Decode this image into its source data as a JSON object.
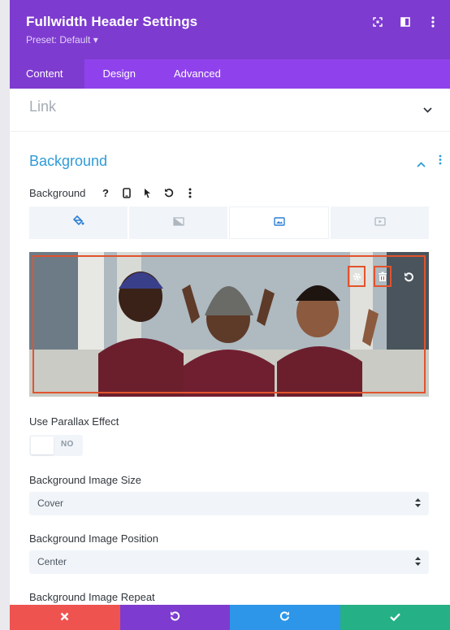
{
  "header": {
    "title": "Fullwidth Header Settings",
    "preset": "Preset: Default ▾",
    "icons": [
      "focus-icon",
      "split-view-icon",
      "more-vertical-icon"
    ],
    "color": "#7e3bd0"
  },
  "tabs": [
    {
      "label": "Content",
      "active": true
    },
    {
      "label": "Design",
      "active": false
    },
    {
      "label": "Advanced",
      "active": false
    }
  ],
  "sections": {
    "link": {
      "label": "Link",
      "expanded": false
    },
    "background": {
      "label": "Background",
      "expanded": true
    }
  },
  "background_option": {
    "label": "Background",
    "help_glyph": "?",
    "tools": [
      "help-icon",
      "device-phone-icon",
      "hover-pointer-icon",
      "reset-icon",
      "more-vertical-icon"
    ],
    "type_tabs": [
      {
        "name": "color-fill-icon",
        "active": false
      },
      {
        "name": "gradient-icon",
        "active": false
      },
      {
        "name": "image-icon",
        "active": true
      },
      {
        "name": "video-icon",
        "active": false
      }
    ],
    "image_actions": [
      "settings-gear-icon",
      "trash-icon",
      "reset-icon"
    ]
  },
  "fields": {
    "parallax": {
      "label": "Use Parallax Effect",
      "value": "NO"
    },
    "image_size": {
      "label": "Background Image Size",
      "value": "Cover"
    },
    "image_position": {
      "label": "Background Image Position",
      "value": "Center"
    },
    "image_repeat": {
      "label": "Background Image Repeat"
    }
  },
  "bottom_bar": {
    "buttons": [
      {
        "name": "discard",
        "color": "#ef5350"
      },
      {
        "name": "undo",
        "color": "#7e3bd0"
      },
      {
        "name": "redo",
        "color": "#2d96e8"
      },
      {
        "name": "save",
        "color": "#25b085"
      }
    ]
  }
}
